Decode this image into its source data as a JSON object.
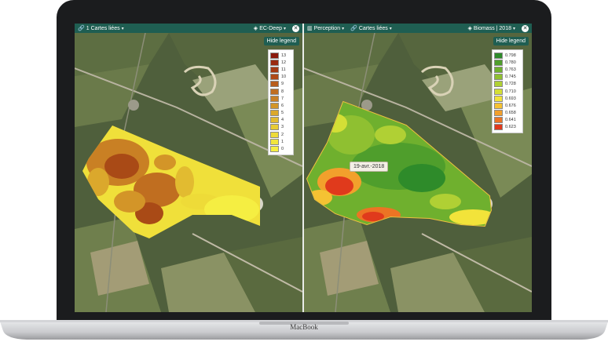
{
  "device": {
    "brand": "MacBook"
  },
  "left_pane": {
    "toolbar": {
      "link_count": "1",
      "linked_maps_label": "Cartes liées",
      "layer_label": "EC-Deep",
      "close_glyph": "✕"
    },
    "hide_legend_label": "Hide legend",
    "legend": {
      "entries": [
        {
          "label": "13",
          "color": "#8b1a0d"
        },
        {
          "label": "12",
          "color": "#9a2a10"
        },
        {
          "label": "11",
          "color": "#a53a14"
        },
        {
          "label": "10",
          "color": "#b04a18"
        },
        {
          "label": "9",
          "color": "#b85d1c"
        },
        {
          "label": "8",
          "color": "#c06e20"
        },
        {
          "label": "7",
          "color": "#c98024"
        },
        {
          "label": "6",
          "color": "#d39528"
        },
        {
          "label": "5",
          "color": "#dba82c"
        },
        {
          "label": "4",
          "color": "#e2bb30"
        },
        {
          "label": "3",
          "color": "#e8cc34"
        },
        {
          "label": "2",
          "color": "#eedb38"
        },
        {
          "label": "1",
          "color": "#f2e63c"
        },
        {
          "label": "0",
          "color": "#f5ee42"
        }
      ]
    }
  },
  "right_pane": {
    "toolbar": {
      "layer_label": "Perception",
      "linked_maps_label": "Cartes liées",
      "product_label": "Biomass | 2018",
      "close_glyph": "✕"
    },
    "hide_legend_label": "Hide legend",
    "date_tooltip": "19-avr.-2018",
    "legend": {
      "entries": [
        {
          "label": "0.798",
          "color": "#2e8b2a"
        },
        {
          "label": "0.780",
          "color": "#4f9e2c"
        },
        {
          "label": "0.763",
          "color": "#6fb02e"
        },
        {
          "label": "0.745",
          "color": "#8fc031"
        },
        {
          "label": "0.728",
          "color": "#b0d034"
        },
        {
          "label": "0.710",
          "color": "#d4df36"
        },
        {
          "label": "0.693",
          "color": "#f2e33a"
        },
        {
          "label": "0.676",
          "color": "#f5c233"
        },
        {
          "label": "0.658",
          "color": "#f2a02c"
        },
        {
          "label": "0.641",
          "color": "#ec7424"
        },
        {
          "label": "0.623",
          "color": "#e03a1c"
        }
      ]
    }
  }
}
